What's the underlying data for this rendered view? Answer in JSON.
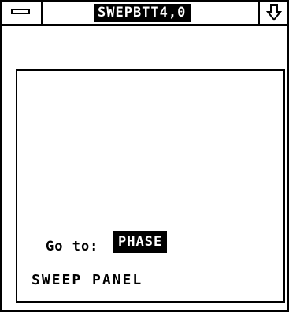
{
  "window": {
    "title": "SWEPBTT4,0"
  },
  "icons": {
    "system_menu": "system-menu-icon",
    "scroll": "down-arrow-icon"
  },
  "panel": {
    "goto_label": "Go to:",
    "goto_value": "PHASE",
    "name": "SWEEP PANEL"
  },
  "colors": {
    "foreground": "#000000",
    "background": "#ffffff"
  }
}
